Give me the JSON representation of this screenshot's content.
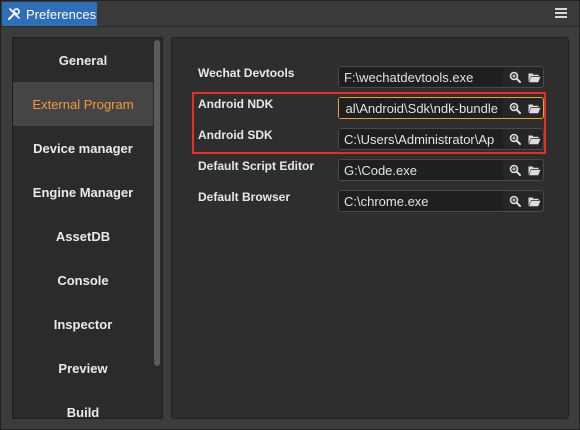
{
  "window": {
    "tab_label": "Preferences",
    "tab_icon": "tools-icon",
    "menu_icon": "hamburger-menu-icon"
  },
  "sidebar": {
    "items": [
      {
        "label": "General",
        "active": false
      },
      {
        "label": "External Program",
        "active": true
      },
      {
        "label": "Device manager",
        "active": false
      },
      {
        "label": "Engine Manager",
        "active": false
      },
      {
        "label": "AssetDB",
        "active": false
      },
      {
        "label": "Console",
        "active": false
      },
      {
        "label": "Inspector",
        "active": false
      },
      {
        "label": "Preview",
        "active": false
      },
      {
        "label": "Build",
        "active": false
      }
    ]
  },
  "settings": {
    "wechat_devtools": {
      "label": "Wechat Devtools",
      "value": "F:\\wechatdevtools.exe"
    },
    "android_ndk": {
      "label": "Android NDK",
      "value": "al\\Android\\Sdk\\ndk-bundle"
    },
    "android_sdk": {
      "label": "Android SDK",
      "value": "C:\\Users\\Administrator\\Ap"
    },
    "default_script_editor": {
      "label": "Default Script Editor",
      "value": "G:\\Code.exe"
    },
    "default_browser": {
      "label": "Default Browser",
      "value": "C:\\chrome.exe"
    }
  },
  "colors": {
    "tab_blue": "#2f6fb8",
    "active_item_orange": "#f09a3e",
    "focus_border": "#e8a33d",
    "highlight_red": "#e8301e"
  },
  "icons": {
    "search": "magnifier-icon",
    "folder": "folder-open-icon"
  }
}
